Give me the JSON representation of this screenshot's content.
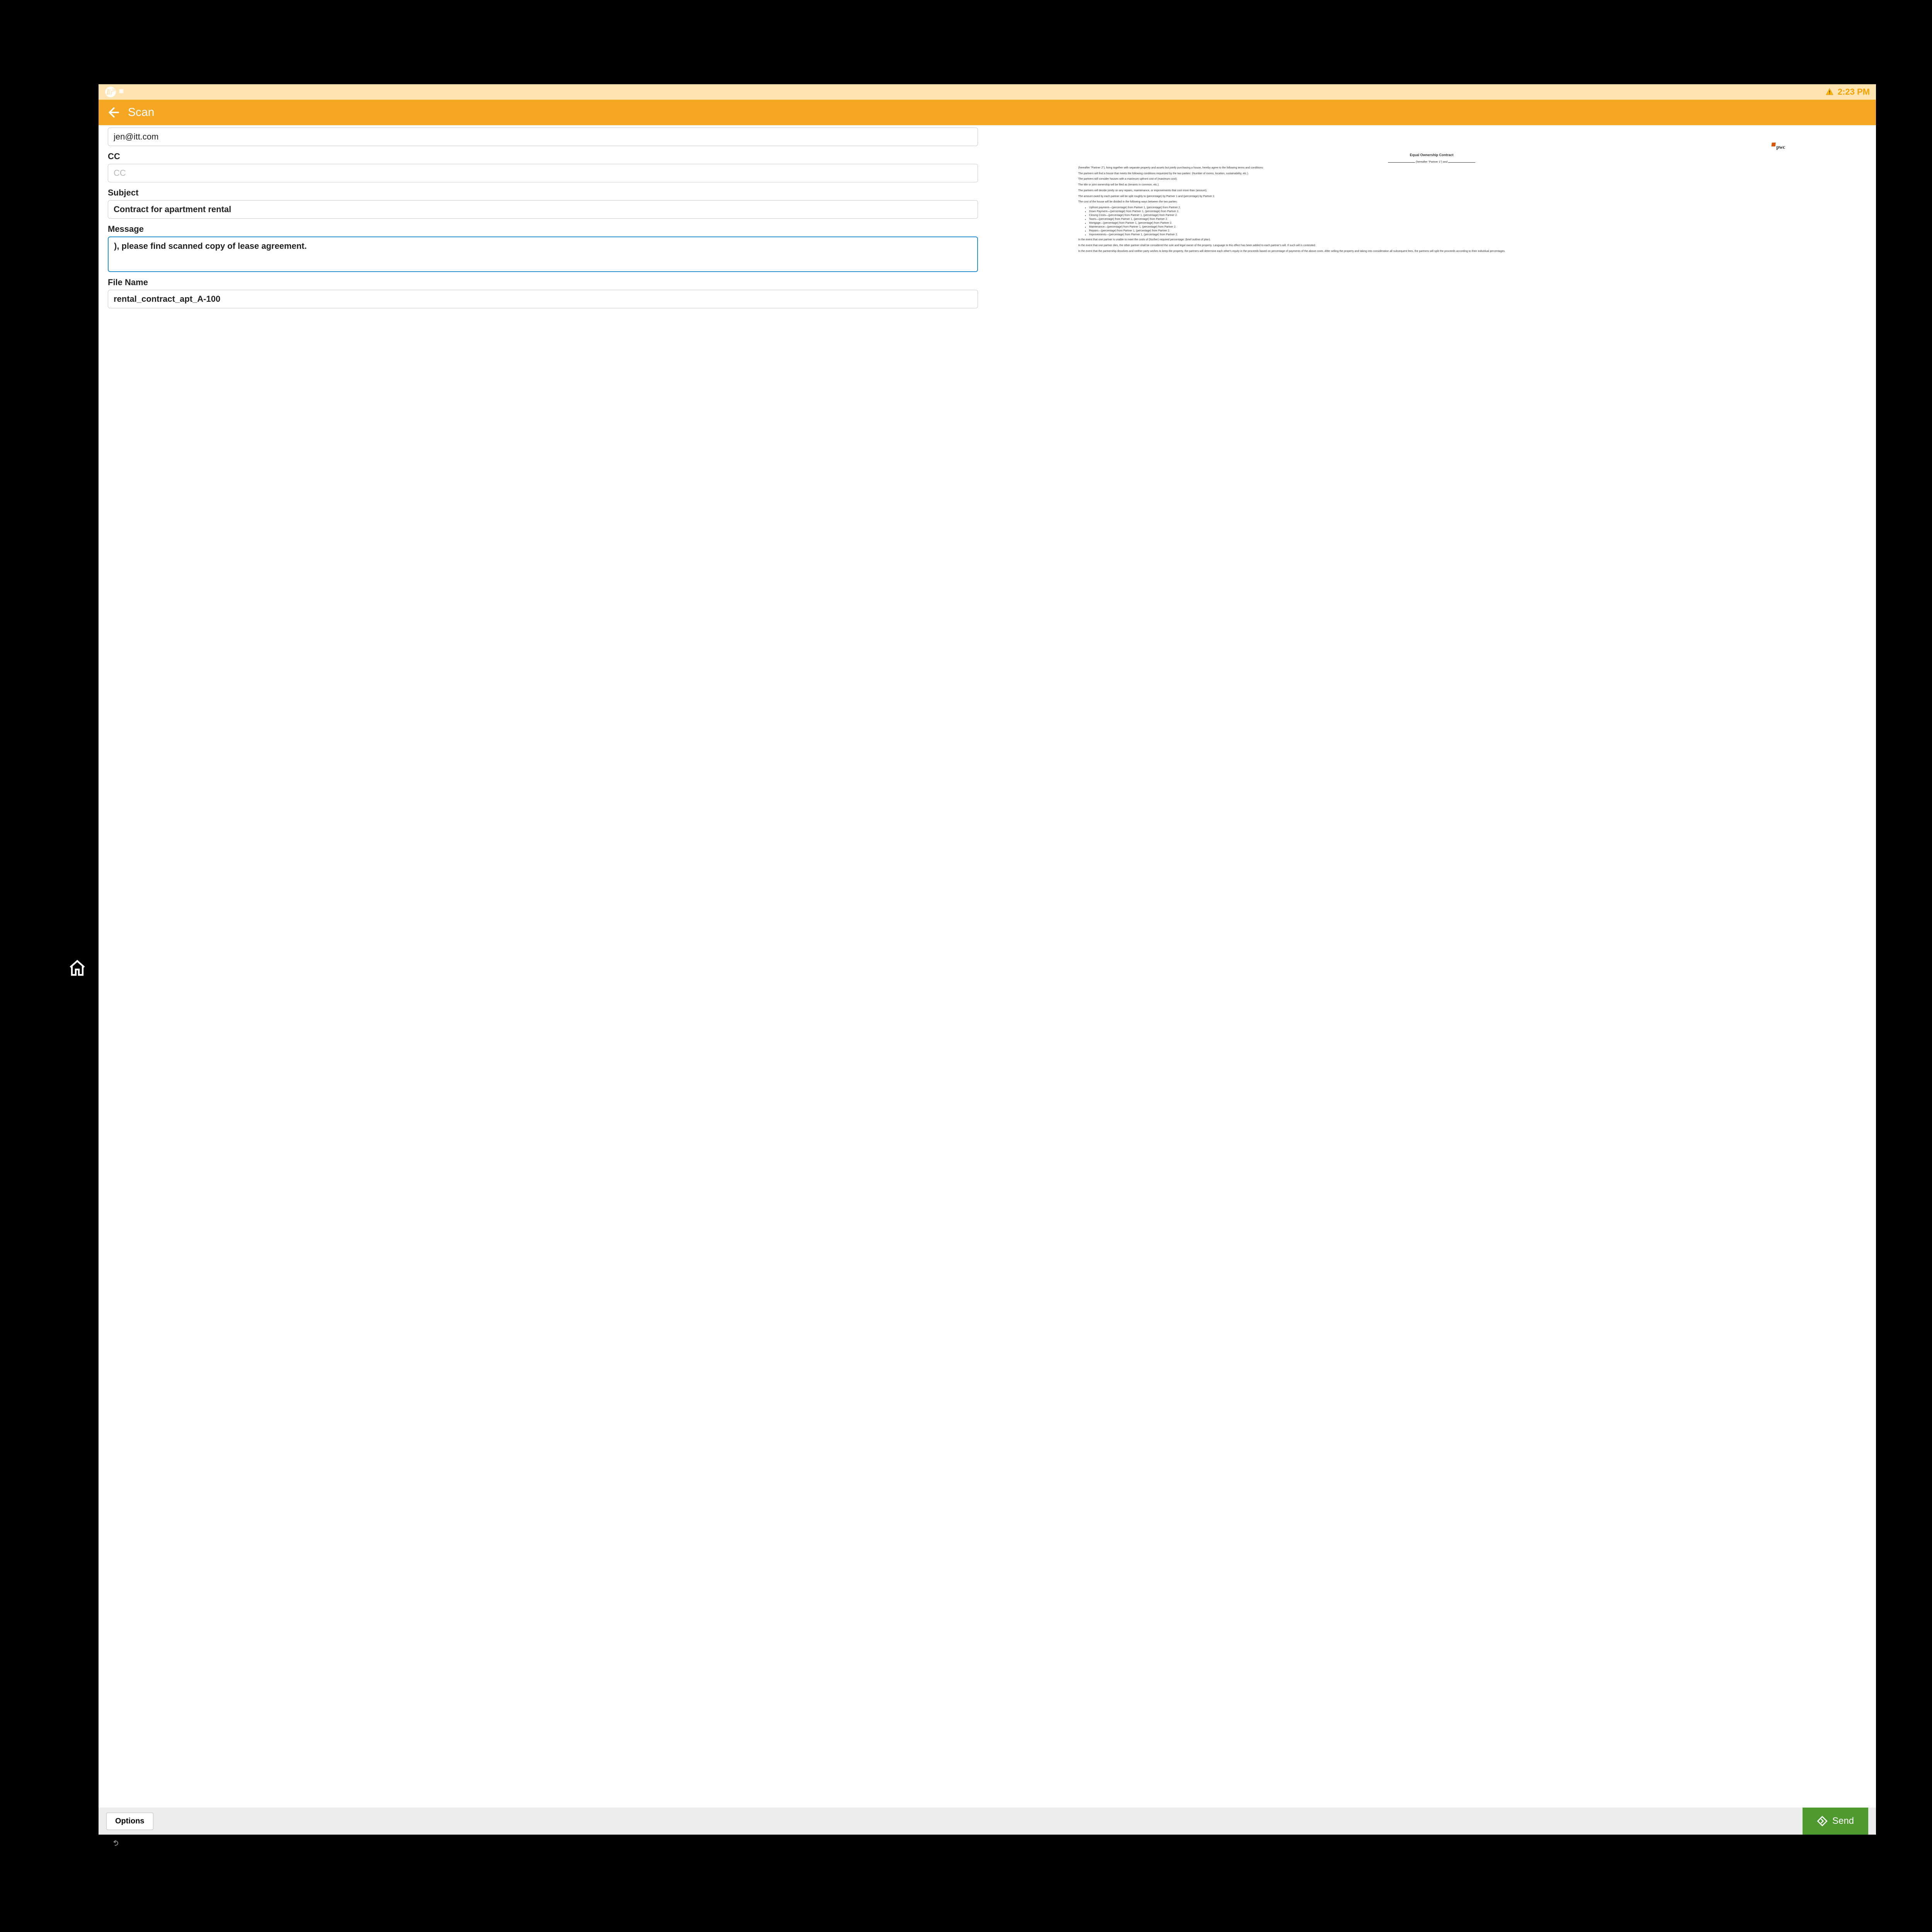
{
  "status": {
    "time": "2:23 PM"
  },
  "title": "Scan",
  "form": {
    "to_value": "jen@itt.com",
    "cc_label": "CC",
    "cc_placeholder": "CC",
    "subject_label": "Subject",
    "subject_value": "Contract for apartment rental",
    "message_label": "Message",
    "message_value": "), please find scanned copy of lease agreement.",
    "filename_label": "File Name",
    "filename_value": "rental_contract_apt_A-100"
  },
  "footer": {
    "options_label": "Options",
    "send_label": "Send"
  },
  "preview": {
    "logo_text": "pwc",
    "title": "Equal Ownership Contract",
    "intro_a": "(hereafter \"Partner 1\") and",
    "intro_b": "(hereafter \"Partner 2\"), living together with separate property and assets but jointly purchasing a house, hereby agree to the following terms and conditions:",
    "p1": "The partners will find a house that meets the following conditions requested by the two parties: (Number of rooms, location, sustainability, etc.).",
    "p2": "The partners will consider houses with a maximum upfront cost of (maximum cost).",
    "p3": "The title or joint ownership will be filed as (tenants in common, etc.).",
    "p4": "The partners will decide jointly on any repairs, maintenance, or improvements that cost more than (amount).",
    "p5": "The amount owed by each partner will be split roughly to (percentage) by Partner 1 and (percentage) by Partner 2.",
    "p6": "The cost of the house will be divided in the following ways between the two parties:",
    "li1": "Upfront payment—(percentage) from Partner 1, (percentage) from Partner 2.",
    "li2": "Down Payment—(percentage) from Partner 1, (percentage) from Partner 2.",
    "li3": "Closing Costs—(percentage) from Partner 1, (percentage) from Partner 2.",
    "li4": "Taxes—(percentage) from Partner 1, (percentage) from Partner 2.",
    "li5": "Mortgage—(percentage) from Partner 1, (percentage) from Partner 2.",
    "li6": "Maintenance—(percentage) from Partner 1, (percentage) from Partner 2.",
    "li7": "Repairs—(percentage) from Partner 1, (percentage) from Partner 2.",
    "li8": "Improvements—(percentage) from Partner 1, (percentage) from Partner 2.",
    "p7": "In the event that one partner is unable to meet the costs of (his/her) required percentage: (brief outline of plan).",
    "p8": "In the event that one partner dies, the other partner shall be considered the sole and legal owner of the property. Language to this effect has been added to each partner's will. If such will is contested:",
    "p9": "In the event that the partnership dissolves and neither party wishes to keep the property, the partners will determine each other's equity in the proceeds based on percentage of payments of the above costs. After selling the property and taking into consideration all subsequent fees, the partners will split the proceeds according to their individual percentages."
  }
}
